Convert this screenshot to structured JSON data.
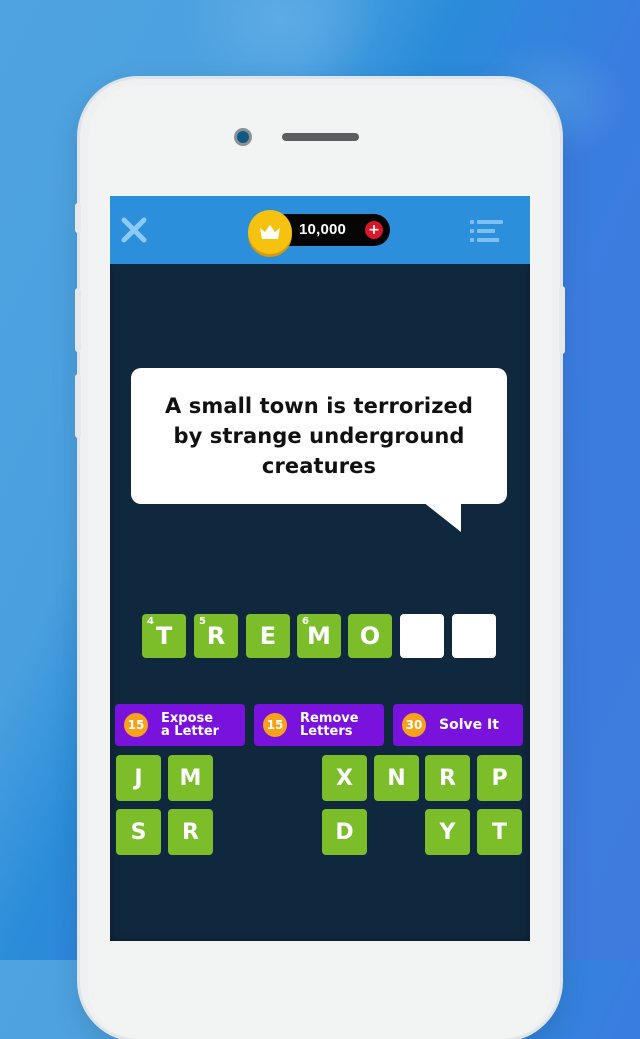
{
  "topbar": {
    "close_icon": "close-x-icon",
    "coins": {
      "icon": "crown-icon",
      "value": "10,000",
      "add_label": "+"
    },
    "menu_icon": "list-menu-icon"
  },
  "clue": {
    "text": "A small town is terrorized by strange underground creatures"
  },
  "answer": {
    "slots": [
      {
        "letter": "T",
        "hint_number": "4"
      },
      {
        "letter": "R",
        "hint_number": "5"
      },
      {
        "letter": "E",
        "hint_number": ""
      },
      {
        "letter": "M",
        "hint_number": "6"
      },
      {
        "letter": "O",
        "hint_number": ""
      },
      {
        "letter": "",
        "hint_number": ""
      },
      {
        "letter": "",
        "hint_number": ""
      }
    ]
  },
  "hints": [
    {
      "cost": "15",
      "line1": "Expose",
      "line2": "a Letter"
    },
    {
      "cost": "15",
      "line1": "Remove",
      "line2": "Letters"
    },
    {
      "cost": "30",
      "line1": "Solve It",
      "line2": ""
    }
  ],
  "keyboard": {
    "row1": [
      "J",
      "M",
      "",
      "",
      "X",
      "N",
      "R",
      "P"
    ],
    "row2": [
      "S",
      "R",
      "",
      "",
      "D",
      "",
      "Y",
      "T"
    ]
  },
  "colors": {
    "topbar": "#2b8fdb",
    "screen_bg": "#10283d",
    "tile_green": "#7cbe2a",
    "hint_purple": "#7a12de",
    "hint_badge": "#f7a21a",
    "coin_gold": "#f6c20f",
    "plus_red": "#d8182a"
  }
}
